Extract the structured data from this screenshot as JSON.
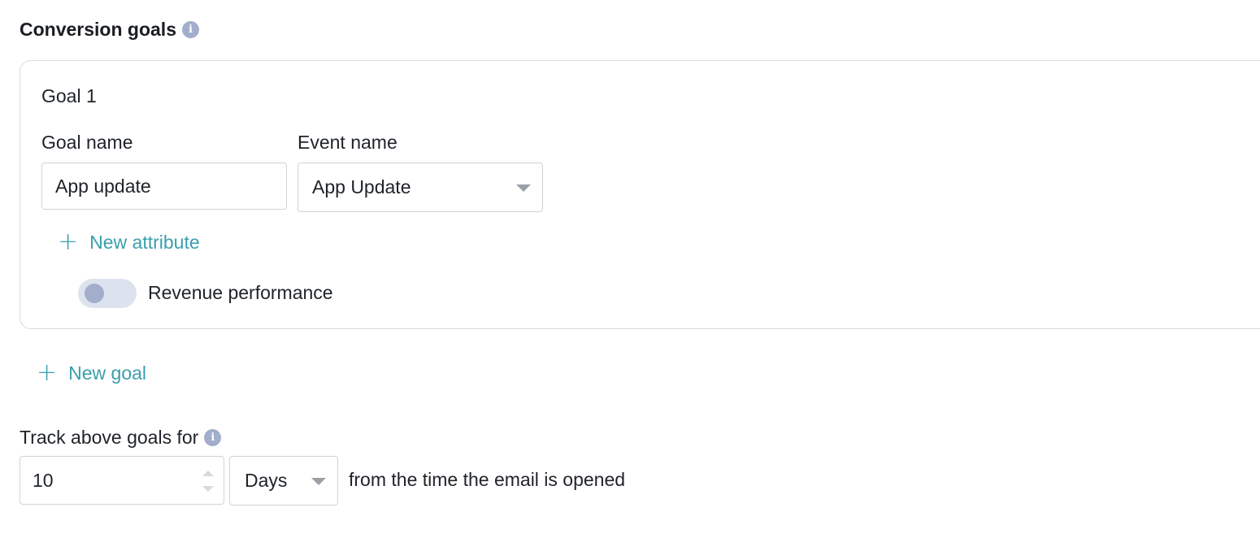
{
  "colors": {
    "accent": "#3a9fac",
    "info_icon": "#a2aecb",
    "border": "#d8dbe0",
    "toggle_track": "#dde3ee",
    "text": "#1f2329"
  },
  "section": {
    "title": "Conversion goals",
    "info_icon_glyph": "i"
  },
  "goal": {
    "heading": "Goal 1",
    "goal_name_label": "Goal name",
    "goal_name_value": "App update",
    "event_name_label": "Event name",
    "event_name_value": "App Update",
    "new_attribute_label": "New attribute",
    "revenue_toggle_label": "Revenue performance",
    "revenue_toggle_on": false
  },
  "new_goal_label": "New goal",
  "tracking": {
    "label": "Track above goals for",
    "info_icon_glyph": "i",
    "duration_value": "10",
    "unit_value": "Days",
    "suffix": "from the time the email is opened"
  },
  "icons": {
    "plus": "+",
    "info": "info-icon",
    "caret": "chevron-down-icon"
  }
}
